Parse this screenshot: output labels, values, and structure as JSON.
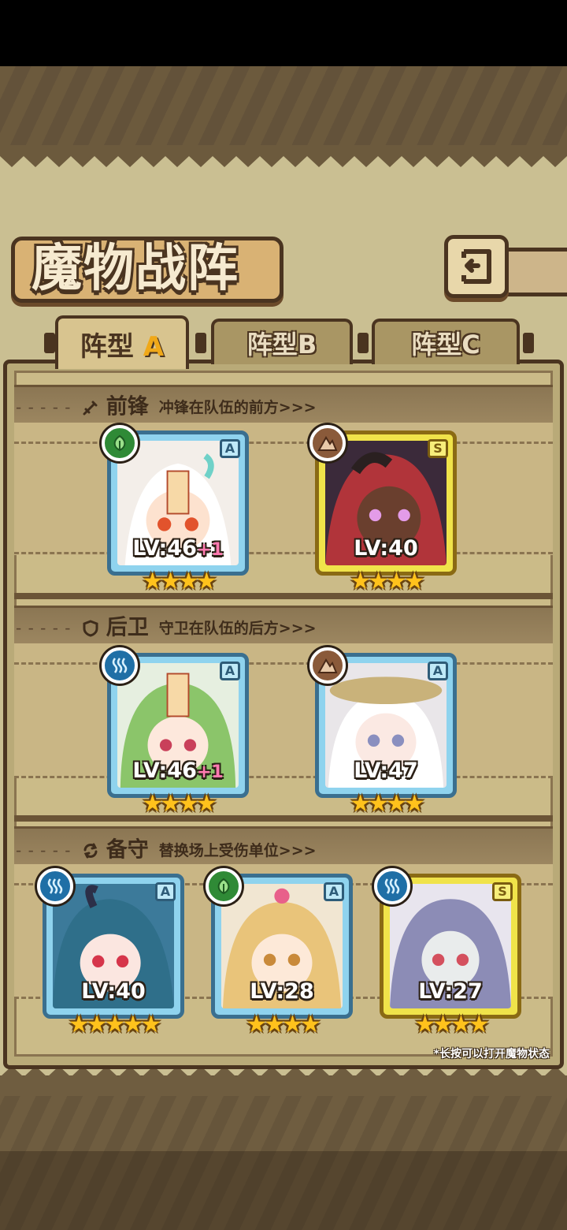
{
  "screen": {
    "title": "魔物战阵"
  },
  "tabs": [
    {
      "label_main": "阵型",
      "label_letter": "A",
      "active": true
    },
    {
      "label_main": "阵型",
      "label_letter": "B",
      "active": false
    },
    {
      "label_main": "阵型",
      "label_letter": "C",
      "active": false
    }
  ],
  "sections": {
    "front": {
      "name": "前锋",
      "desc": "冲锋在队伍的前方>>>",
      "icon": "sword-icon"
    },
    "rear": {
      "name": "后卫",
      "desc": "守卫在队伍的后方>>>",
      "icon": "shield-icon"
    },
    "reserve": {
      "name": "备守",
      "desc": "替换场上受伤单位>>>",
      "icon": "swap-icon"
    }
  },
  "cards": {
    "front1": {
      "rank": "A",
      "level": "LV:46",
      "plus": "+1",
      "stars": "★★★★",
      "element": "nature",
      "frame": "blue"
    },
    "front2": {
      "rank": "S",
      "level": "LV:40",
      "plus": "",
      "stars": "★★★★",
      "element": "earth",
      "frame": "gold"
    },
    "rear1": {
      "rank": "A",
      "level": "LV:46",
      "plus": "+1",
      "stars": "★★★★",
      "element": "water",
      "frame": "blue"
    },
    "rear2": {
      "rank": "A",
      "level": "LV:47",
      "plus": "",
      "stars": "★★★★",
      "element": "earth",
      "frame": "blue"
    },
    "reserve1": {
      "rank": "A",
      "level": "LV:40",
      "plus": "",
      "stars": "★★★★★",
      "element": "water",
      "frame": "blue"
    },
    "reserve2": {
      "rank": "A",
      "level": "LV:28",
      "plus": "",
      "stars": "★★★★",
      "element": "nature",
      "frame": "blue"
    },
    "reserve3": {
      "rank": "S",
      "level": "LV:27",
      "plus": "",
      "stars": "★★★★",
      "element": "water",
      "frame": "gold"
    }
  },
  "hint": "*长按可以打开魔物状态",
  "colors": {
    "parchment": "#cabf92",
    "ink": "#4a3420",
    "frame_blue": "#8fd3ee",
    "frame_gold": "#f0e34a",
    "star": "#ffc21c"
  }
}
